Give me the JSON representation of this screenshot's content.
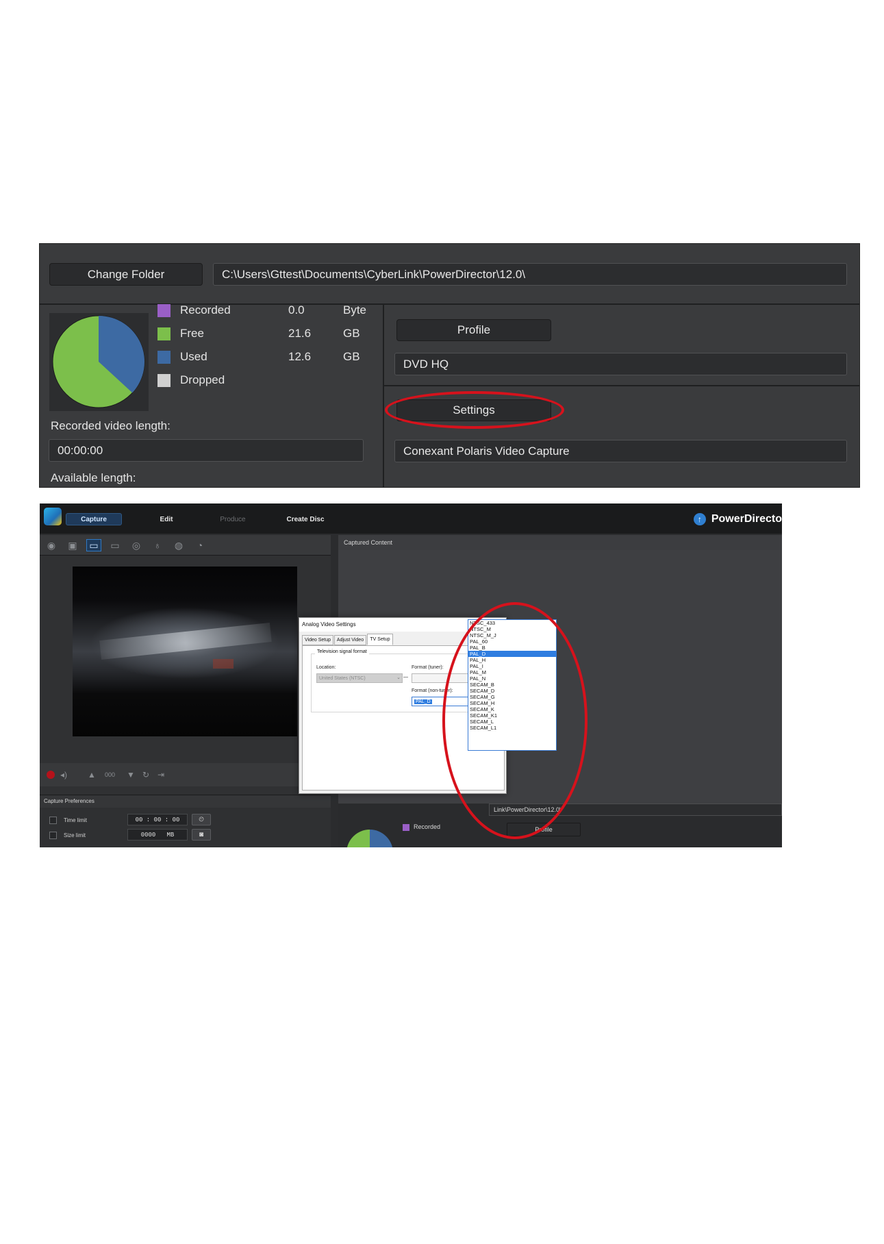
{
  "capture_panel": {
    "change_folder_label": "Change Folder",
    "folder_path": "C:\\Users\\Gttest\\Documents\\CyberLink\\PowerDirector\\12.0\\",
    "disk_usage": [
      {
        "label": "Recorded",
        "value": "0.0",
        "unit": "Byte",
        "color": "#9a5fc7"
      },
      {
        "label": "Free",
        "value": "21.6",
        "unit": "GB",
        "color": "#7cbf4b"
      },
      {
        "label": "Used",
        "value": "12.6",
        "unit": "GB",
        "color": "#3d6aa3"
      },
      {
        "label": "Dropped",
        "value": "",
        "unit": "",
        "color": "#d0d0d0"
      }
    ],
    "recorded_length_label": "Recorded video length:",
    "recorded_length_value": "00:00:00",
    "available_length_label": "Available length:",
    "profile_label": "Profile",
    "profile_value": "DVD HQ",
    "settings_label": "Settings",
    "device_value": "Conexant Polaris Video Capture",
    "highlight_color": "#d6121c"
  },
  "app": {
    "nav_tabs": [
      {
        "label": "Capture",
        "state": "active"
      },
      {
        "label": "Edit",
        "state": "normal"
      },
      {
        "label": "Produce",
        "state": "disabled"
      },
      {
        "label": "Create Disc",
        "state": "normal"
      }
    ],
    "brand": "PowerDirecto",
    "brand_icon": "upgrade-arrow-icon",
    "toolbar_icons": [
      "webcam-icon",
      "camcorder-icon",
      "tv-tuner-icon",
      "digital-tv-icon",
      "webcam-alt-icon",
      "microphone-icon",
      "cd-icon",
      "dvd-icon"
    ],
    "captured_content_label": "Captured Content",
    "controls": {
      "counter": "000"
    },
    "capture_preferences": {
      "title": "Capture Preferences",
      "time_limit_label": "Time limit",
      "time_limit_value": "00 : 00 : 00",
      "size_limit_label": "Size limit",
      "size_limit_value": "0000",
      "size_limit_unit": "MB"
    },
    "path_fragment": "Link\\PowerDirector\\12.0\\",
    "mini_recorded_label": "Recorded",
    "mini_profile_label": "Profile"
  },
  "dialog": {
    "title": "Analog Video Settings",
    "tabs": [
      "Video Setup",
      "Adjust Video",
      "TV Setup"
    ],
    "active_tab": "TV Setup",
    "group_title": "Television signal format",
    "location_label": "Location:",
    "location_value": "United States (NTSC)",
    "format_tuner_label": "Format (tuner):",
    "format_nontuner_label": "Format (non-tuner):",
    "format_options": [
      "NTSC_433",
      "NTSC_M",
      "NTSC_M_J",
      "PAL_60",
      "PAL_B",
      "PAL_D",
      "PAL_H",
      "PAL_I",
      "PAL_M",
      "PAL_N",
      "SECAM_B",
      "SECAM_D",
      "SECAM_G",
      "SECAM_H",
      "SECAM_K",
      "SECAM_K1",
      "SECAM_L",
      "SECAM_L1"
    ],
    "selected_option": "PAL_D"
  }
}
